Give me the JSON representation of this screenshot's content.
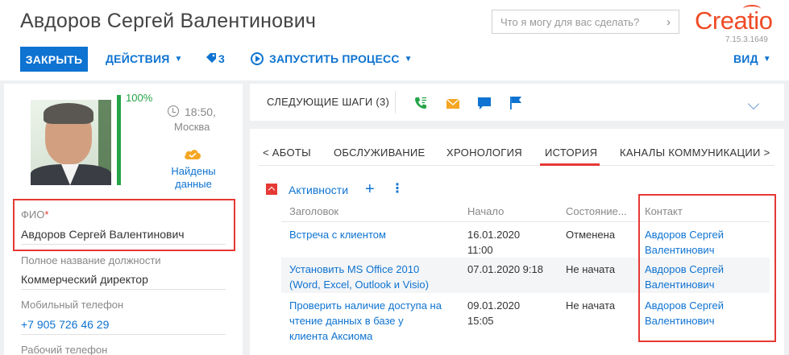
{
  "header": {
    "title": "Авдоров Сергей Валентинович",
    "search_placeholder": "Что я могу для вас сделать?",
    "logo": "Creatio",
    "version": "7.15.3.1649"
  },
  "toolbar": {
    "close_label": "ЗАКРЫТЬ",
    "actions_label": "ДЕЙСТВИЯ",
    "tags_count": "3",
    "run_process_label": "ЗАПУСТИТЬ ПРОЦЕСС",
    "view_label": "ВИД"
  },
  "profile": {
    "completeness_percent": 100,
    "completeness_label": "100%",
    "local_time": "18:50,",
    "city": "Москва",
    "found_data_label": "Найдены данные"
  },
  "fields": [
    {
      "label": "ФИО",
      "required": true,
      "value": "Авдоров Сергей Валентинович",
      "is_link": false
    },
    {
      "label": "Полное название должности",
      "required": false,
      "value": "Коммерческий директор",
      "is_link": false
    },
    {
      "label": "Мобильный телефон",
      "required": false,
      "value": "+7 905 726 46 29",
      "is_link": true
    },
    {
      "label": "Рабочий телефон",
      "required": false,
      "value": "",
      "is_link": false
    }
  ],
  "next_steps": {
    "title": "СЛЕДУЮЩИЕ ШАГИ (3)",
    "icons": [
      "phone-icon",
      "email-icon",
      "chat-icon",
      "flag-icon"
    ],
    "icon_colors": {
      "phone": "#24a446",
      "email": "#f5a623",
      "chat": "#0e73d1",
      "flag": "#0e73d1"
    }
  },
  "tabs": [
    {
      "label": "< АБОТЫ",
      "active": false
    },
    {
      "label": "ОБСЛУЖИВАНИЕ",
      "active": false
    },
    {
      "label": "ХРОНОЛОГИЯ",
      "active": false
    },
    {
      "label": "ИСТОРИЯ",
      "active": true
    },
    {
      "label": "КАНАЛЫ КОММУНИКАЦИИ >",
      "active": false
    }
  ],
  "activities": {
    "title": "Активности",
    "columns": [
      "Заголовок",
      "Начало",
      "Состояние...",
      "Контакт"
    ],
    "rows": [
      {
        "title": [
          "Встреча с клиентом"
        ],
        "start": [
          "16.01.2020",
          "11:00"
        ],
        "state": "Отменена",
        "contact": [
          "Авдоров Сергей",
          "Валентинович"
        ]
      },
      {
        "title": [
          "Установить MS Office 2010",
          "(Word, Excel, Outlook и Visio)"
        ],
        "start": [
          "07.01.2020 9:18"
        ],
        "state": "Не начата",
        "contact": [
          "Авдоров Сергей",
          "Валентинович"
        ]
      },
      {
        "title": [
          "Проверить наличие доступа на",
          "чтение данных в базе у",
          "клиента Аксиома"
        ],
        "start": [
          "09.01.2020",
          "15:05"
        ],
        "state": "Не начата",
        "contact": [
          "Авдоров Сергей",
          "Валентинович"
        ]
      }
    ]
  },
  "colors": {
    "accent": "#0e73d1",
    "highlight": "#e53935",
    "success": "#24a446",
    "logo": "#ef4a24"
  }
}
